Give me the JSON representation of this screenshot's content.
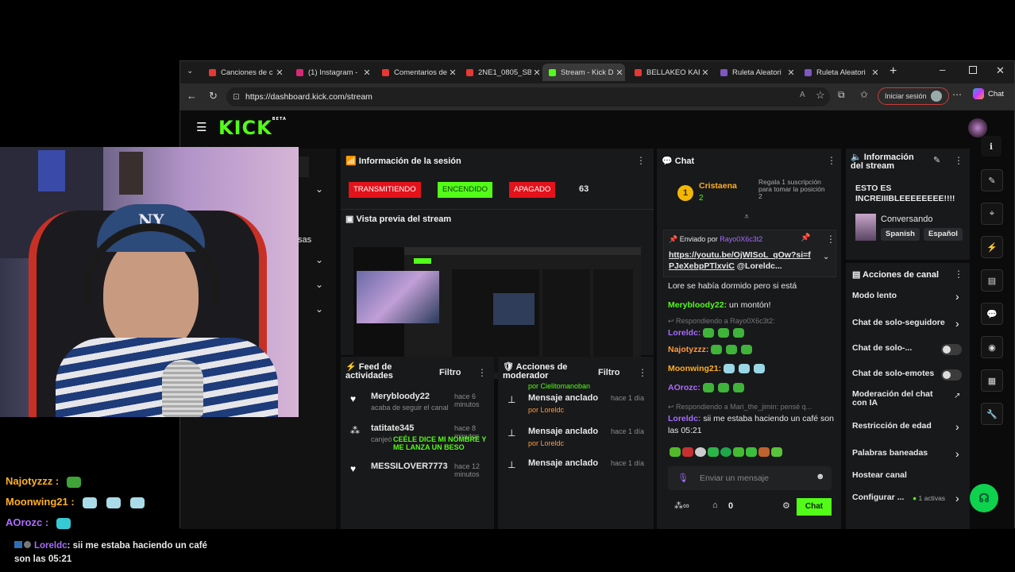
{
  "browser": {
    "tabs": [
      {
        "title": "Canciones de c",
        "color": "#e53935"
      },
      {
        "title": "(1) Instagram -",
        "color": "#d62976"
      },
      {
        "title": "Comentarios de",
        "color": "#e53935"
      },
      {
        "title": "2NE1_0805_SBS",
        "color": "#e53935"
      },
      {
        "title": "Stream - Kick D",
        "color": "#53fc18"
      },
      {
        "title": "BELLAKEO KAR",
        "color": "#e53935"
      },
      {
        "title": "Ruleta Aleatori",
        "color": "#7e57c2"
      },
      {
        "title": "Ruleta Aleatori",
        "color": "#7e57c2"
      }
    ],
    "url": "https://dashboard.kick.com/stream",
    "signin_label": "Iniciar sesión",
    "chat_label": "Chat"
  },
  "kick": {
    "logo": "KICK",
    "beta": "BETA"
  },
  "sidebar": {
    "partial_label": "sas"
  },
  "session": {
    "title": "Información de la sesión",
    "badges": {
      "live": "TRANSMITIENDO",
      "on": "ENCENDIDO",
      "off": "APAGADO"
    },
    "viewers": "63",
    "preview_title": "Vista previa del stream"
  },
  "feed": {
    "title": "Feed de actividades",
    "filter": "Filtro",
    "items": [
      {
        "user": "Merybloody22",
        "time": "hace 6 minutos",
        "text": "acaba de seguir el canal",
        "highlight": ""
      },
      {
        "user": "tatitate345",
        "time": "hace 8 minutos",
        "text": "canjeó",
        "highlight": "CEÉLE DICE MI NOMBRE Y ME LANZA UN BESO"
      },
      {
        "user": "MESSILOVER7773",
        "time": "hace 12 minutos",
        "text": "",
        "highlight": ""
      }
    ]
  },
  "modactions": {
    "title": "Acciones de moderador",
    "filter": "Filtro",
    "cut": "por Cielitomanoban",
    "items": [
      {
        "text": "Mensaje anclado",
        "by": "por Loreldc",
        "time": "hace 1 día"
      },
      {
        "text": "Mensaje anclado",
        "by": "por Loreldc",
        "time": "hace 1 día"
      },
      {
        "text": "Mensaje anclado",
        "by": "",
        "time": "hace 1 día"
      }
    ]
  },
  "chat": {
    "title": "Chat",
    "gift_rank": "1",
    "gift_user": "Cristaena",
    "gift_count": "2",
    "gift_text": "Regala 1 suscripción para tomar la posición 2",
    "pinned_label": "Enviado por",
    "pinned_user": "Rayo0X6c3t2",
    "pinned_link": "https://youtu.be/OjWISoL_qOw?si=fPJeXebpPTlxviC",
    "pinned_mention": "@Loreldc...",
    "messages": [
      {
        "user": "",
        "text": "Lore se había dormido pero si está"
      },
      {
        "user": "Merybloody22:",
        "text": "un montón!"
      },
      {
        "reply": "Respondiendo a Rayo0X6c3t2:",
        "user": "Loreldc:",
        "text": ""
      },
      {
        "user": "Najotyzzz:",
        "text": ""
      },
      {
        "user": "Moonwing21:",
        "text": ""
      },
      {
        "user": "AOrozc:",
        "text": ""
      },
      {
        "reply": "Respondiendo a Mari_the_jimin: pensé q...",
        "user": "Loreldc:",
        "text": "sii me estaba haciendo un café son las 05:21"
      }
    ],
    "input_placeholder": "Enviar un mensaje",
    "count_a": "0",
    "send_label": "Chat"
  },
  "streaminfo": {
    "title": "Información del stream",
    "stream_title": "ESTO ES INCREIIIBLEEEEEEEE!!!!",
    "category": "Conversando",
    "tags": [
      "Spanish",
      "Español"
    ]
  },
  "actions": {
    "title": "Acciones de canal",
    "items": [
      {
        "label": "Modo lento",
        "control": "chevron"
      },
      {
        "label": "Chat de solo-seguidore",
        "control": "chevron"
      },
      {
        "label": "Chat de solo-...",
        "control": "toggle"
      },
      {
        "label": "Chat de solo-emotes",
        "control": "toggle"
      },
      {
        "label": "Moderación del chat con IA",
        "control": "external"
      },
      {
        "label": "Restricción de edad",
        "control": "chevron"
      },
      {
        "label": "Palabras baneadas",
        "control": "chevron"
      },
      {
        "label": "Hostear canal",
        "control": "none"
      },
      {
        "label": "Configurar ...",
        "control": "chevron",
        "extra": "1 activas"
      }
    ]
  },
  "overlay": {
    "lines": [
      {
        "user": "Najotyzzz :",
        "color": "#ffb020"
      },
      {
        "user": "Moonwing21 :",
        "color": "#ffb020"
      },
      {
        "user": "AOrozc :",
        "color": "#b06bff"
      }
    ],
    "last_user": "Loreldc",
    "last_text": ": sii me estaba haciendo un café son las 05:21"
  },
  "colors": {
    "accent": "#53fc18",
    "red": "#e3121b"
  }
}
